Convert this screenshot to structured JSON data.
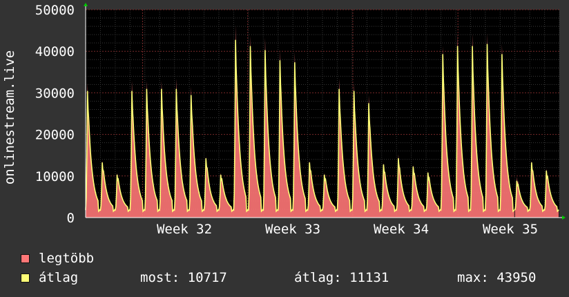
{
  "chart_data": {
    "type": "area",
    "ylabel": "onlinestream.live",
    "ylim": [
      0,
      50000
    ],
    "y_ticks": [
      0,
      10000,
      20000,
      30000,
      40000,
      50000
    ],
    "x_ticks": [
      "Week 32",
      "Week 33",
      "Week 34",
      "Week 35"
    ],
    "grid": true,
    "legend_placement": "bottom-left",
    "series": [
      {
        "name": "legtöbb",
        "color": "#ff7777",
        "kind": "area",
        "daily_peaks": [
          33000,
          14000,
          11000,
          33500,
          33500,
          33500,
          34000,
          32000,
          15000,
          11000,
          47000,
          44500,
          44000,
          41000,
          40500,
          14000,
          11000,
          34000,
          33000,
          30000,
          13500,
          15500,
          13000,
          11500,
          42000,
          45000,
          45000,
          45000,
          42500,
          10000,
          14000,
          12000
        ]
      },
      {
        "name": "átlag",
        "color": "#ffff77",
        "kind": "line",
        "daily_peaks": [
          31000,
          13500,
          10500,
          31000,
          31500,
          31500,
          31500,
          30000,
          14500,
          10500,
          43500,
          42000,
          41000,
          38500,
          38000,
          13500,
          10500,
          31500,
          31000,
          28000,
          13000,
          14500,
          12500,
          11000,
          40000,
          42000,
          42000,
          42500,
          40000,
          9000,
          13500,
          11500
        ]
      }
    ],
    "data_gap_day": 29
  },
  "legend": {
    "max_label": "legtöbb",
    "avg_label": "átlag",
    "max_color": "#ff7777",
    "avg_color": "#ffff77"
  },
  "stats": {
    "now": "most: 10717",
    "avg": "átlag: 11131",
    "max": "max: 43950"
  }
}
